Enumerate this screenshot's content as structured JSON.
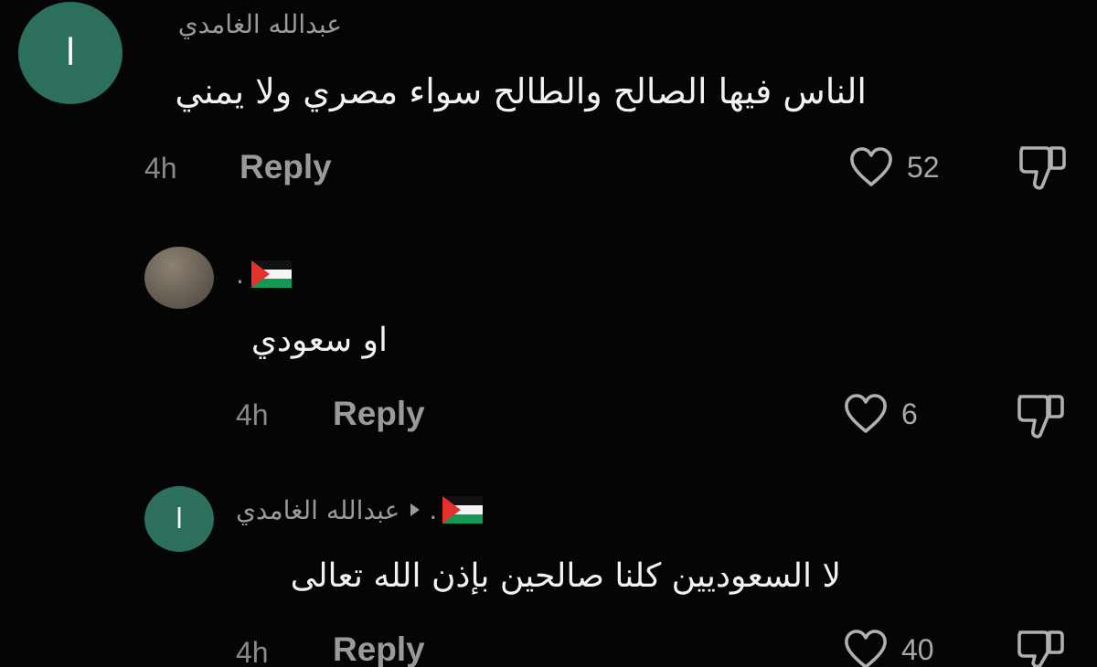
{
  "theme": {
    "background": "#050505",
    "avatar_color": "#2b6f5c",
    "text_primary": "#f2f2f2",
    "text_secondary": "#9a9a9a"
  },
  "comments": [
    {
      "avatar_letter": "ا",
      "username": "عبدالله الغامدي",
      "text": "الناس فيها الصالح والطالح سواء مصري ولا يمني",
      "time": "4h",
      "reply_label": "Reply",
      "likes": "52",
      "icons": [
        "heart-icon",
        "thumbs-down-icon"
      ]
    },
    {
      "username_flag": "palestine-flag",
      "username_suffix": ".",
      "text": "او سعودي",
      "time": "4h",
      "reply_label": "Reply",
      "likes": "6",
      "icons": [
        "heart-icon",
        "thumbs-down-icon"
      ]
    },
    {
      "avatar_letter": "ا",
      "username": "عبدالله الغامدي",
      "reply_to_flag": "palestine-flag",
      "reply_to_suffix": ".",
      "text": "لا السعوديين كلنا صالحين بإذن الله تعالى",
      "time": "4h",
      "reply_label": "Reply",
      "likes": "40",
      "icons": [
        "heart-icon",
        "thumbs-down-icon"
      ]
    }
  ]
}
